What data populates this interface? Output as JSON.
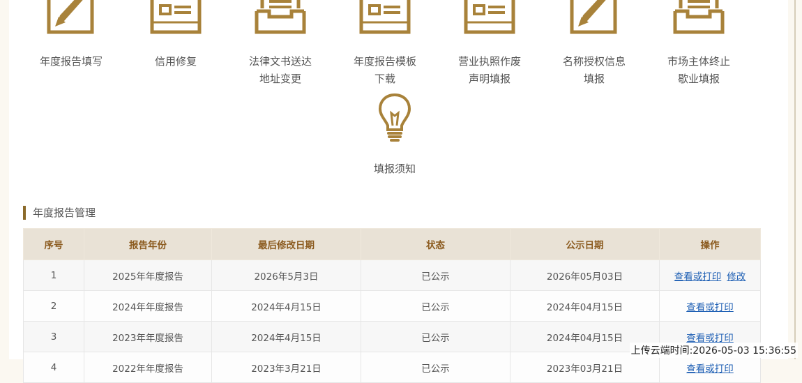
{
  "services": [
    {
      "icon": "pen-edit-icon",
      "label": "年度报告填写"
    },
    {
      "icon": "document-icon",
      "label": "信用修复"
    },
    {
      "icon": "inbox-tray-icon",
      "label": "法律文书送达\n地址变更"
    },
    {
      "icon": "document-icon",
      "label": "年度报告模板\n下载"
    },
    {
      "icon": "document-icon",
      "label": "营业执照作废\n声明填报"
    },
    {
      "icon": "pen-edit-icon",
      "label": "名称授权信息\n填报"
    },
    {
      "icon": "inbox-tray-icon",
      "label": "市场主体终止\n歇业填报"
    },
    {
      "icon": "lightbulb-icon",
      "label": "填报须知"
    }
  ],
  "section": {
    "title": "年度报告管理"
  },
  "table": {
    "headers": [
      "序号",
      "报告年份",
      "最后修改日期",
      "状态",
      "公示日期",
      "操作"
    ],
    "rows": [
      {
        "no": "1",
        "year": "2025年年度报告",
        "modified": "2026年5月3日",
        "status": "已公示",
        "published": "2026年05月03日",
        "actions": [
          "查看或打印",
          "修改"
        ]
      },
      {
        "no": "2",
        "year": "2024年年度报告",
        "modified": "2024年4月15日",
        "status": "已公示",
        "published": "2024年04月15日",
        "actions": [
          "查看或打印"
        ]
      },
      {
        "no": "3",
        "year": "2023年年度报告",
        "modified": "2024年4月15日",
        "status": "已公示",
        "published": "2024年04月15日",
        "actions": [
          "查看或打印"
        ]
      },
      {
        "no": "4",
        "year": "2022年年度报告",
        "modified": "2023年3月21日",
        "status": "已公示",
        "published": "2023年03月21日",
        "actions": [
          "查看或打印"
        ]
      }
    ]
  },
  "upload_time": "上传云端时间:2026-05-03 15:36:55",
  "colors": {
    "accent": "#a8823a",
    "link": "#1e5fb4",
    "header_bg": "#e9e2d6"
  }
}
